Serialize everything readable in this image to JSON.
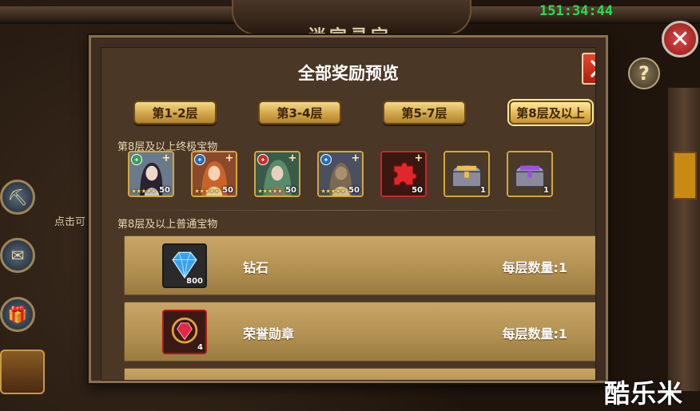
{
  "background": {
    "title": "迷宫寻宝",
    "timer": "151:34:44",
    "hint_text": "点击可",
    "close_icon": "close-icon",
    "help_icon": "help-icon"
  },
  "watermark": "酷乐米",
  "modal": {
    "title": "全部奖励预览",
    "close_icon": "close-x-icon",
    "tabs": [
      {
        "label": "第1-2层",
        "active": false
      },
      {
        "label": "第3-4层",
        "active": false
      },
      {
        "label": "第5-7层",
        "active": false
      },
      {
        "label": "第8层及以上",
        "active": true
      }
    ],
    "ultimate_section": {
      "label": "第8层及以上终极宝物",
      "items": [
        {
          "icon": "hero-portrait-icon",
          "count": "50",
          "stars": "★★★★★"
        },
        {
          "icon": "hero-portrait-icon",
          "count": "50",
          "stars": "★★★★★"
        },
        {
          "icon": "hero-portrait-icon",
          "count": "50",
          "stars": "★★★★★"
        },
        {
          "icon": "hero-portrait-icon",
          "count": "50",
          "stars": "★★★★★"
        },
        {
          "icon": "puzzle-piece-icon",
          "count": "50"
        },
        {
          "icon": "gold-chest-icon",
          "count": "1"
        },
        {
          "icon": "purple-chest-icon",
          "count": "1"
        }
      ]
    },
    "normal_section": {
      "label": "第8层及以上普通宝物",
      "rows": [
        {
          "icon": "diamond-icon",
          "count": "800",
          "name": "钻石",
          "qty": "每层数量:1"
        },
        {
          "icon": "honor-medal-icon",
          "count": "4",
          "name": "荣誉勋章",
          "qty": "每层数量:1"
        }
      ]
    }
  },
  "colors": {
    "timer": "#26e04a",
    "tab_gold": "#d2a648",
    "row_gold": "#b08f50",
    "close_red": "#d4351c"
  }
}
